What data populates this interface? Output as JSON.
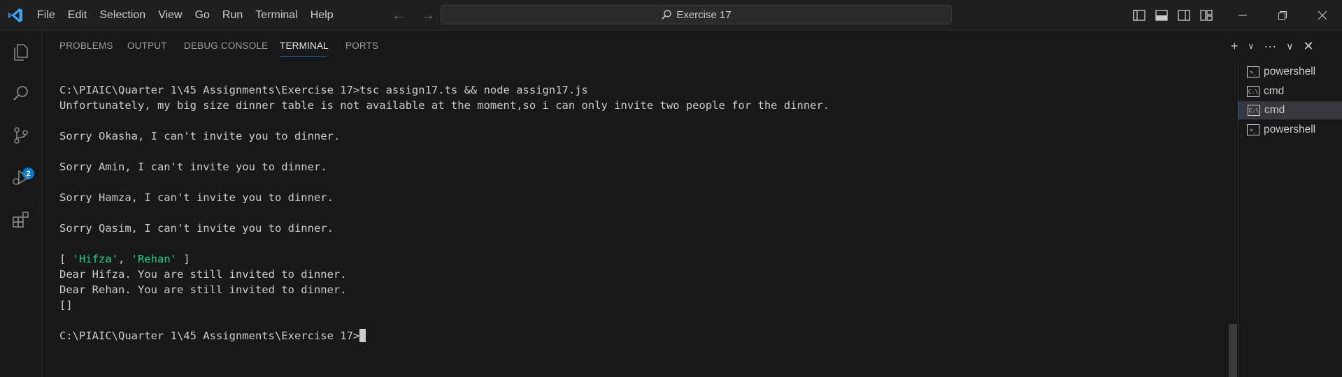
{
  "menu": [
    "File",
    "Edit",
    "Selection",
    "View",
    "Go",
    "Run",
    "Terminal",
    "Help"
  ],
  "command_center": {
    "label": "Exercise 17"
  },
  "activity": {
    "source_control_badge": "2"
  },
  "panel": {
    "tabs": [
      "PROBLEMS",
      "OUTPUT",
      "DEBUG CONSOLE",
      "TERMINAL",
      "PORTS"
    ],
    "active_tab": "TERMINAL"
  },
  "terminal": {
    "lines": [
      "C:\\PIAIC\\Quarter 1\\45 Assignments\\Exercise 17>tsc assign17.ts && node assign17.js",
      "Unfortunately, my big size dinner table is not available at the moment,so i can only invite two people for the dinner.",
      "",
      "Sorry Okasha, I can't invite you to dinner.",
      "",
      "Sorry Amin, I can't invite you to dinner.",
      "",
      "Sorry Hamza, I can't invite you to dinner.",
      "",
      "Sorry Qasim, I can't invite you to dinner.",
      "",
      "[ 'Hifza', 'Rehan' ]",
      "Dear Hifza. You are still invited to dinner.",
      "Dear Rehan. You are still invited to dinner.",
      "[]",
      "",
      "C:\\PIAIC\\Quarter 1\\45 Assignments\\Exercise 17>"
    ],
    "array_line": {
      "open": "[ ",
      "item1": "'Hifza'",
      "sep": ", ",
      "item2": "'Rehan'",
      "close": " ]"
    }
  },
  "terminal_list": [
    {
      "label": "powershell",
      "icon": "powershell-icon",
      "selected": false
    },
    {
      "label": "cmd",
      "icon": "cmd-icon",
      "selected": false
    },
    {
      "label": "cmd",
      "icon": "cmd-icon",
      "selected": true
    },
    {
      "label": "powershell",
      "icon": "powershell-icon",
      "selected": false
    }
  ],
  "colors": {
    "accent": "#0078d4",
    "string": "#23d18b",
    "background": "#181818"
  }
}
